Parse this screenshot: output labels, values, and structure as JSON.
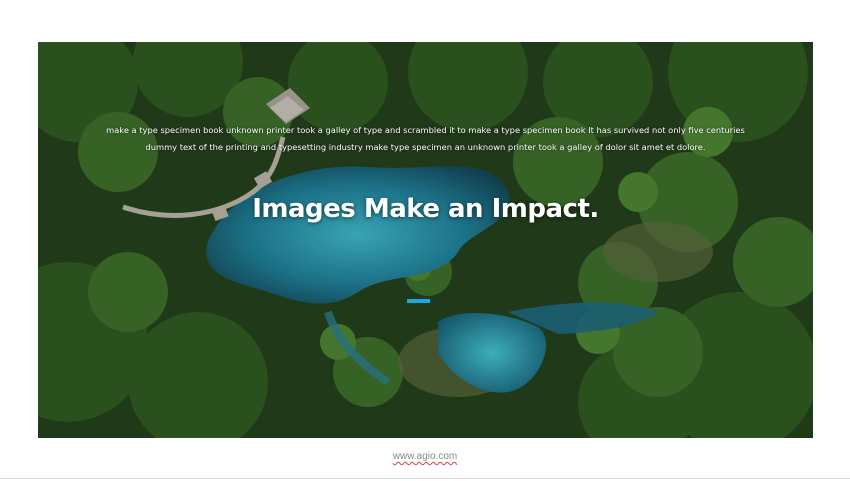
{
  "hero": {
    "intro_line_1": "make a type specimen book unknown printer took a galley of type and scrambled it to make a type specimen book It has survived not only five centuries",
    "intro_line_2": "dummy text of the printing and typesetting industry make type specimen an unknown printer took a galley of dolor sit amet et dolore.",
    "headline": "Images Make an Impact.",
    "background_image": "aerial-forest-lake-photo",
    "accent_color": "#1ea7e8"
  },
  "footer": {
    "link_text": "www.agio.com"
  }
}
